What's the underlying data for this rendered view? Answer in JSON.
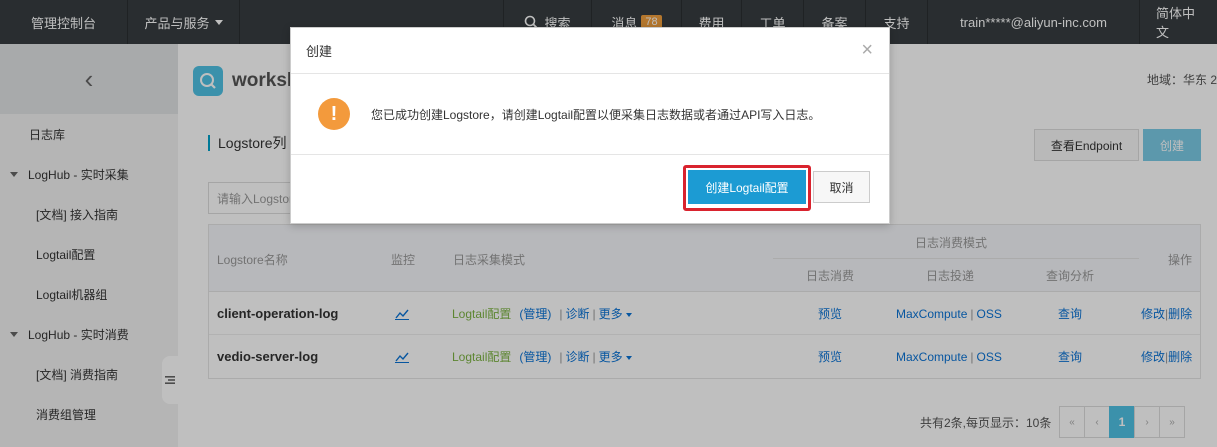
{
  "topbar": {
    "brand": "管理控制台",
    "products": "产品与服务",
    "search": "搜索",
    "messages": "消息",
    "messages_count": "78",
    "billing": "费用",
    "ticket": "工单",
    "filing": "备案",
    "support": "支持",
    "account": "train*****@aliyun-inc.com",
    "language": "简体中文"
  },
  "sidebar": {
    "back_glyph": "‹",
    "items": [
      {
        "label": "日志库"
      },
      {
        "label": "LogHub - 实时采集"
      },
      {
        "label": "[文档] 接入指南"
      },
      {
        "label": "Logtail配置"
      },
      {
        "label": "Logtail机器组"
      },
      {
        "label": "LogHub - 实时消费"
      },
      {
        "label": "[文档] 消费指南"
      },
      {
        "label": "消费组管理"
      }
    ]
  },
  "main": {
    "project_title": "worksh",
    "region": "地域：华东 2",
    "section_title": "Logstore列",
    "endpoint_button": "查看Endpoint",
    "create_button": "创建",
    "search_placeholder": "请输入Logstore"
  },
  "table": {
    "headers": {
      "name": "Logstore名称",
      "monitor": "监控",
      "collect_mode": "日志采集模式",
      "consume_mode": "日志消费模式",
      "consume": "日志消费",
      "ship": "日志投递",
      "query": "查询分析",
      "actions": "操作"
    },
    "rows": [
      {
        "name": "client-operation-log",
        "logtail": "Logtail配置",
        "manage": "(管理)",
        "sep1": "|",
        "diagnose": "诊断",
        "sep2": "|",
        "more": "更多",
        "preview": "预览",
        "maxcompute": "MaxCompute",
        "sep3": "|",
        "oss": "OSS",
        "query": "查询",
        "modify": "修改",
        "sep4": "|",
        "delete": "删除"
      },
      {
        "name": "vedio-server-log",
        "logtail": "Logtail配置",
        "manage": "(管理)",
        "sep1": "|",
        "diagnose": "诊断",
        "sep2": "|",
        "more": "更多",
        "preview": "预览",
        "maxcompute": "MaxCompute",
        "sep3": "|",
        "oss": "OSS",
        "query": "查询",
        "modify": "修改",
        "sep4": "|",
        "delete": "删除"
      }
    ]
  },
  "pagination": {
    "summary": "共有2条,每页显示：10条",
    "first": "«",
    "prev": "‹",
    "current": "1",
    "next": "›",
    "last": "»"
  },
  "modal": {
    "title": "创建",
    "close": "×",
    "message": "您已成功创建Logstore，请创建Logtail配置以便采集日志数据或者通过API写入日志。",
    "ok_button": "创建Logtail配置",
    "cancel_button": "取消"
  },
  "colors": {
    "topbar": "#373d41",
    "accent": "#1c9bd3",
    "warning": "#f39a3c",
    "highlight": "#d9232e"
  }
}
